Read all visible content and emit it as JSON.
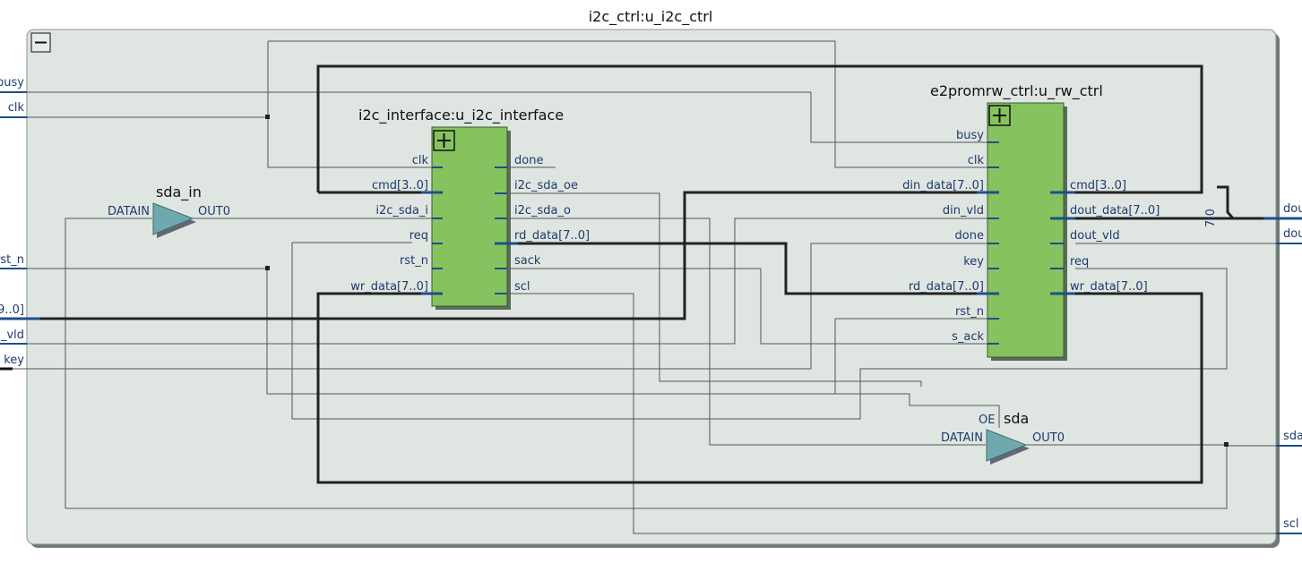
{
  "top_module": {
    "title": "i2c_ctrl:u_i2c_ctrl"
  },
  "external_ports_left": [
    "busy",
    "clk",
    "rst_n",
    "9..0]",
    "_vld",
    "key"
  ],
  "external_ports_right": [
    "dou",
    "dou",
    "sda",
    "scl"
  ],
  "bus_tap_label": "7:0",
  "i2c_interface": {
    "title": "i2c_interface:u_i2c_interface",
    "inputs": [
      "clk",
      "cmd[3..0]",
      "i2c_sda_i",
      "req",
      "rst_n",
      "wr_data[7..0]"
    ],
    "outputs": [
      "done",
      "i2c_sda_oe",
      "i2c_sda_o",
      "rd_data[7..0]",
      "sack",
      "scl"
    ]
  },
  "rw_ctrl": {
    "title": "e2promrw_ctrl:u_rw_ctrl",
    "inputs": [
      "busy",
      "clk",
      "din_data[7..0]",
      "din_vld",
      "done",
      "key",
      "rd_data[7..0]",
      "rst_n",
      "s_ack"
    ],
    "outputs": [
      "cmd[3..0]",
      "dout_data[7..0]",
      "dout_vld",
      "req",
      "wr_data[7..0]"
    ]
  },
  "sda_in_buffer": {
    "name": "sda_in",
    "in": "DATAIN",
    "out": "OUT0"
  },
  "sda_buffer": {
    "name": "sda",
    "oe": "OE",
    "in": "DATAIN",
    "out": "OUT0"
  }
}
